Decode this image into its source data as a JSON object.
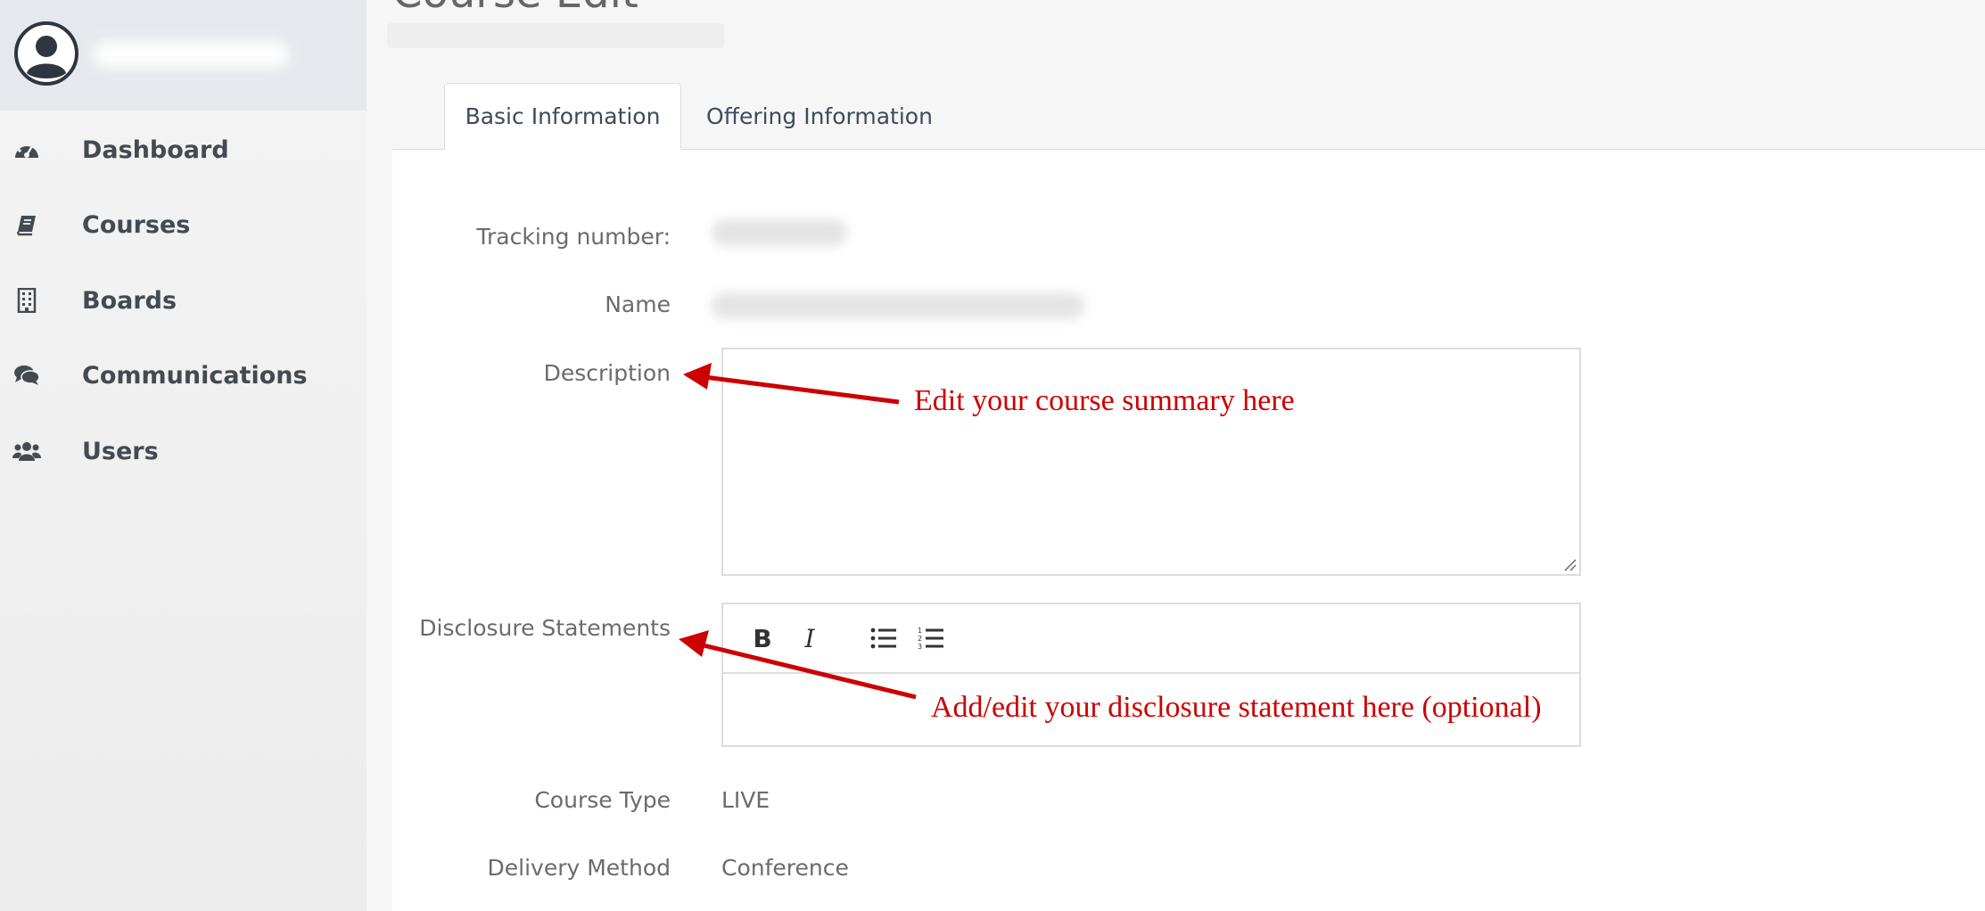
{
  "sidebar": {
    "items": [
      {
        "label": "Dashboard",
        "icon": "dashboard-icon"
      },
      {
        "label": "Courses",
        "icon": "book-icon"
      },
      {
        "label": "Boards",
        "icon": "building-icon"
      },
      {
        "label": "Communications",
        "icon": "comments-icon"
      },
      {
        "label": "Users",
        "icon": "users-icon"
      }
    ]
  },
  "page": {
    "title": "Course Edit"
  },
  "tabs": [
    {
      "label": "Basic Information",
      "active": true
    },
    {
      "label": "Offering Information",
      "active": false
    }
  ],
  "form": {
    "tracking_label": "Tracking number:",
    "name_label": "Name",
    "description_label": "Description",
    "disclosure_label": "Disclosure Statements",
    "course_type_label": "Course Type",
    "course_type_value": "LIVE",
    "delivery_method_label": "Delivery Method",
    "delivery_method_value": "Conference"
  },
  "editor": {
    "toolbar": [
      {
        "label": "B",
        "icon": "bold-icon"
      },
      {
        "label": "I",
        "icon": "italic-icon"
      },
      {
        "label": "",
        "icon": "bulleted-list-icon"
      },
      {
        "label": "",
        "icon": "numbered-list-icon"
      }
    ]
  },
  "annotations": {
    "description_note": "Edit your course summary here",
    "disclosure_note": "Add/edit your disclosure statement here (optional)",
    "color": "#cc0000"
  },
  "colors": {
    "sidebar_header": "#e5e8ec",
    "nav_text": "#444a52",
    "label_text": "#6b6b6b",
    "annotation": "#cc0000"
  }
}
